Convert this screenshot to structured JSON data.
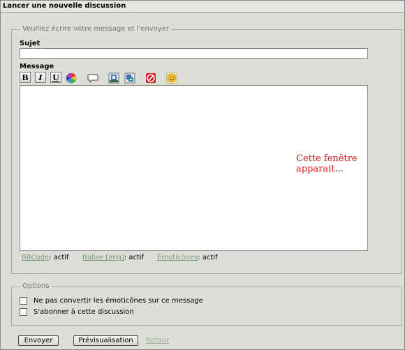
{
  "window": {
    "title": "Lancer une nouvelle discussion"
  },
  "compose": {
    "legend": "Veuillez écrire votre message et l'envoyer",
    "subject_label": "Sujet",
    "subject_value": "",
    "message_label": "Message",
    "message_value": "",
    "toolbar": {
      "bold": "B",
      "italic": "I",
      "underline": "U",
      "icons": [
        "color-wheel-icon",
        "quote-bubble-icon",
        "image-icon",
        "image-url-icon",
        "no-entry-icon",
        "smiley-icon"
      ]
    },
    "status": {
      "bbcode_link": "BBCode",
      "bbcode_value": ": actif",
      "img_link": "Balise [img]",
      "img_value": ": actif",
      "emoticons_link": "Émoticônes",
      "emoticons_value": ": actif"
    }
  },
  "options": {
    "legend": "Options",
    "items": [
      {
        "label": "Ne pas convertir les émoticônes sur ce message",
        "checked": false
      },
      {
        "label": "S'abonner à cette discussion",
        "checked": false
      }
    ]
  },
  "actions": {
    "send": "Envoyer",
    "preview": "Prévisualisation",
    "back": "Retour"
  },
  "annotation": "Cette fenêtre apparait...",
  "colors": {
    "annotation": "#d81818",
    "link": "#7f9a7c",
    "background": "#dcdfd8"
  }
}
